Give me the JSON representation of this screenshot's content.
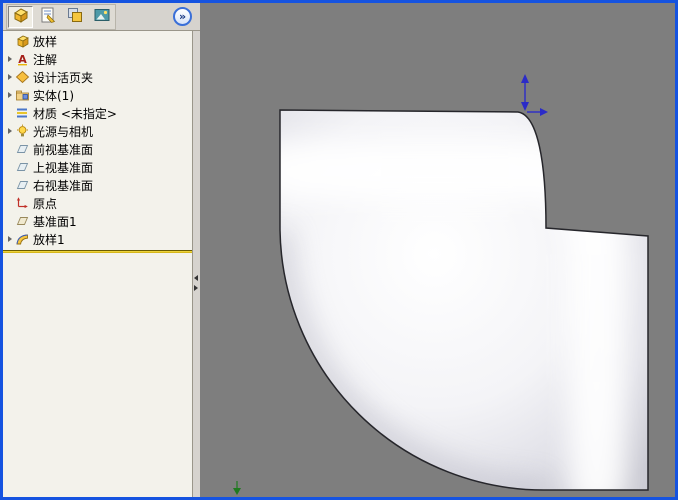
{
  "panel_tabs": {
    "flyout_label": "»",
    "tabs": [
      {
        "icon": "featuremanager-tab-icon",
        "selected": true
      },
      {
        "icon": "propertymanager-tab-icon",
        "selected": false
      },
      {
        "icon": "configurationmanager-tab-icon",
        "selected": false
      },
      {
        "icon": "display-tab-icon",
        "selected": false
      }
    ]
  },
  "feature_tree": {
    "items": [
      {
        "label": "放样",
        "icon": "part-icon",
        "expandable": false
      },
      {
        "label": "注解",
        "icon": "annotations-icon",
        "expandable": true
      },
      {
        "label": "设计活页夹",
        "icon": "design-binder-icon",
        "expandable": true
      },
      {
        "label": "实体(1)",
        "icon": "solid-bodies-icon",
        "expandable": true
      },
      {
        "label": "材质 <未指定>",
        "icon": "material-icon",
        "expandable": false
      },
      {
        "label": "光源与相机",
        "icon": "lights-cameras-icon",
        "expandable": true
      },
      {
        "label": "前视基准面",
        "icon": "plane-icon",
        "expandable": false
      },
      {
        "label": "上视基准面",
        "icon": "plane-icon",
        "expandable": false
      },
      {
        "label": "右视基准面",
        "icon": "plane-icon",
        "expandable": false
      },
      {
        "label": "原点",
        "icon": "origin-icon",
        "expandable": false
      },
      {
        "label": "基准面1",
        "icon": "plane-icon",
        "expandable": false
      },
      {
        "label": "放样1",
        "icon": "loft-icon",
        "expandable": true
      }
    ]
  },
  "viewport": {
    "model": "90-degree elbow solid body",
    "axis_marker_color": "#2B2BC8",
    "origin_marker_color": "#1F7A1F"
  },
  "colors": {
    "window_border": "#1553E0",
    "toolbar_bg": "#D6D3CE",
    "panel_bg": "#F3F2EB",
    "viewport_bg": "#7E7E7E",
    "rollback_bar": "#E3C916"
  }
}
